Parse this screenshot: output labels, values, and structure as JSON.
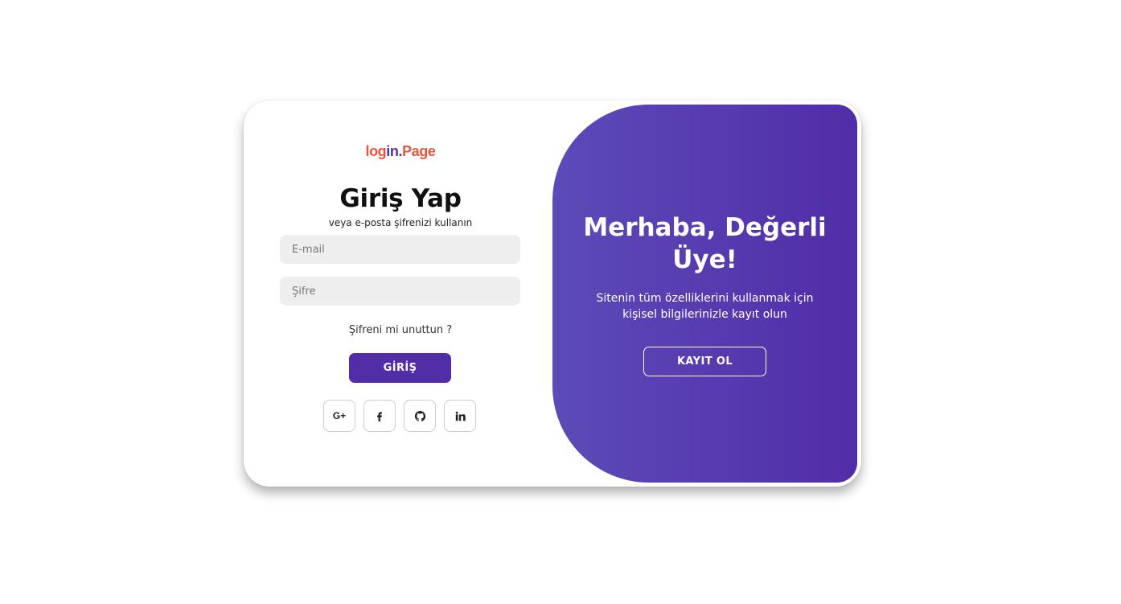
{
  "login": {
    "logo": {
      "part1": "log",
      "part2": "in.",
      "part3": "Page"
    },
    "title": "Giriş Yap",
    "subtitle": "veya e-posta şifrenizi kullanın",
    "email_placeholder": "E-mail",
    "password_placeholder": "Şifre",
    "forgot_text": "Şifreni mi unuttun ?",
    "submit_label": "GİRİŞ",
    "socials": [
      {
        "icon": "google-plus-icon",
        "glyph": "G+"
      },
      {
        "icon": "facebook-icon"
      },
      {
        "icon": "github-icon"
      },
      {
        "icon": "linkedin-icon"
      }
    ]
  },
  "panel": {
    "title": "Merhaba, Değerli Üye!",
    "text": "Sitenin tüm özelliklerini kullanmak için kişisel bilgilerinizle kayıt olun",
    "register_label": "KAYIT OL"
  },
  "colors": {
    "brand_purple": "#512da8",
    "gradient_start": "#5c4bb8",
    "logo_orange": "#e8543c",
    "input_bg": "#eeeeee"
  }
}
